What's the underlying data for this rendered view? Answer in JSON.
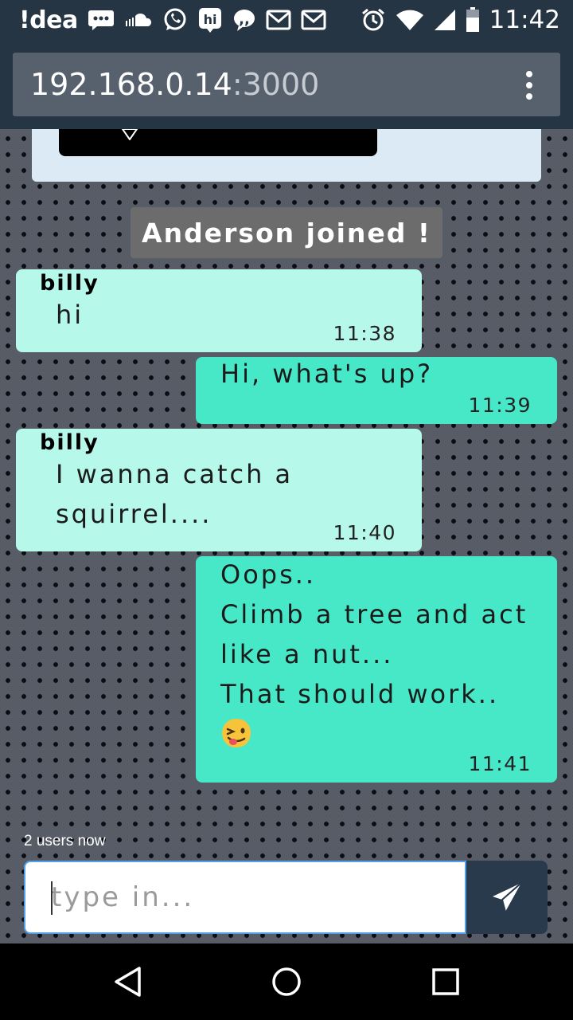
{
  "status_bar": {
    "app_name": "!dea",
    "time": "11:42",
    "icons": [
      "chat-bubble-icon",
      "soundcloud-icon",
      "whatsapp-icon",
      "hi-app-icon",
      "quote-bubble-icon",
      "gmail-icon",
      "gmail-icon",
      "alarm-icon",
      "wifi-icon",
      "signal-icon",
      "battery-icon"
    ]
  },
  "browser": {
    "url_host": "192.168.0.14",
    "url_port": ":3000",
    "menu_icon": "overflow-menu-icon"
  },
  "chat": {
    "system_message": "Anderson joined !",
    "messages": [
      {
        "direction": "in",
        "sender": "billy",
        "text": "hi",
        "time": "11:38"
      },
      {
        "direction": "out",
        "text": "Hi, what's up?",
        "time": "11:39"
      },
      {
        "direction": "in",
        "sender": "billy",
        "text": "I wanna catch a\nsquirrel....",
        "time": "11:40"
      },
      {
        "direction": "out",
        "text": "Oops..\nClimb a tree and act\nlike a nut...\nThat should work..",
        "emoji": "winking-face-tongue-icon",
        "time": "11:41"
      }
    ],
    "users_count": "2 users now",
    "input_placeholder": "type in...",
    "send_icon": "paper-plane-icon"
  },
  "colors": {
    "status_bar_bg": "#263544",
    "url_bar_bg": "#56616d",
    "incoming_bubble": "#b6f8ea",
    "outgoing_bubble": "#47e8c8",
    "system_message_bg": "#6c6c6c",
    "send_button_bg": "#2a3a4d",
    "input_border": "#52a0e8"
  },
  "nav_bar": {
    "icons": [
      "back-icon",
      "home-icon",
      "recents-icon"
    ]
  }
}
